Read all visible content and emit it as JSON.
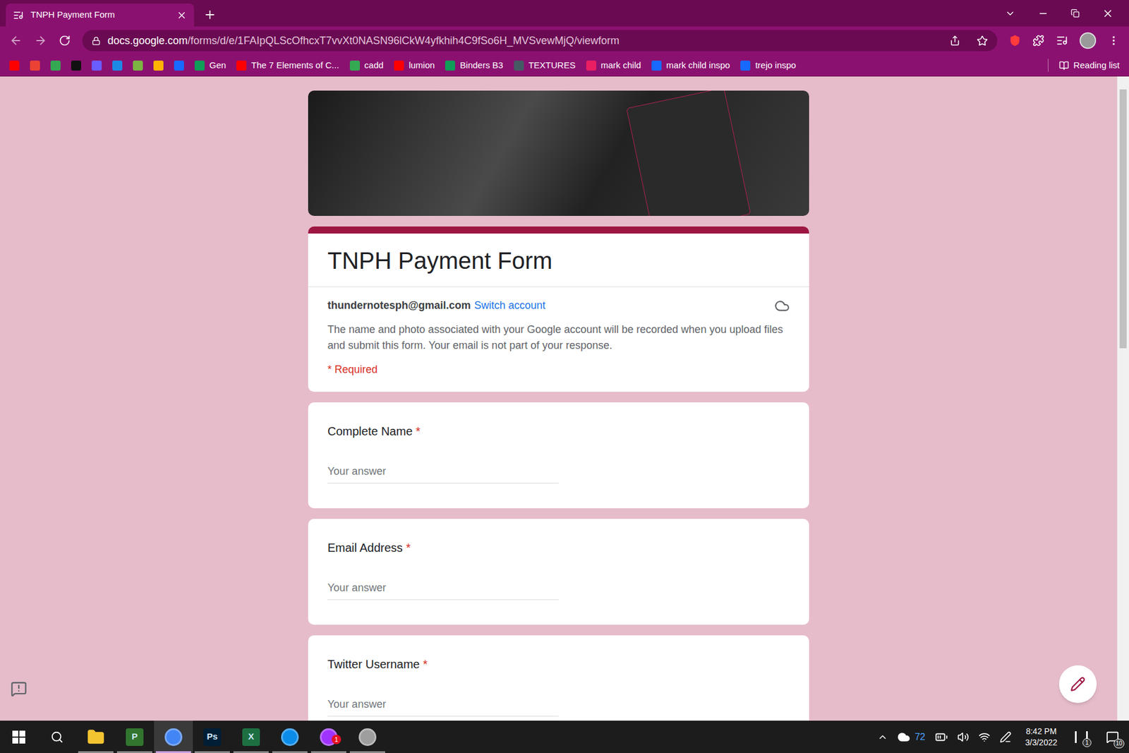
{
  "browser": {
    "tab": {
      "title": "TNPH Payment Form",
      "selected": true
    },
    "url_host": "docs.google.com",
    "url_path": "/forms/d/e/1FAIpQLScOfhcxT7vvXt0NASN96lCkW4yfkhih4C9fSo6H_MVSvewMjQ/viewform"
  },
  "bookmarks": [
    {
      "label": "",
      "color": "#ff0000"
    },
    {
      "label": "",
      "color": "#ea4335"
    },
    {
      "label": "",
      "color": "#34a853"
    },
    {
      "label": "",
      "color": "#111111"
    },
    {
      "label": "",
      "color": "#6a5cff"
    },
    {
      "label": "",
      "color": "#1e88e5"
    },
    {
      "label": "",
      "color": "#7cb342"
    },
    {
      "label": "",
      "color": "#ffb300"
    },
    {
      "label": "",
      "color": "#1769ff"
    },
    {
      "label": "Gen",
      "color": "#0f9d58"
    },
    {
      "label": "The 7 Elements of C...",
      "color": "#ff0000"
    },
    {
      "label": "cadd",
      "color": "#34a853"
    },
    {
      "label": "lumion",
      "color": "#ff0000"
    },
    {
      "label": "Binders B3",
      "color": "#0f9d58"
    },
    {
      "label": "TEXTURES",
      "color": "#455a64"
    },
    {
      "label": "mark child",
      "color": "#e91e63"
    },
    {
      "label": "mark child inspo",
      "color": "#1769ff"
    },
    {
      "label": "trejo inspo",
      "color": "#1769ff"
    }
  ],
  "reading_list": "Reading list",
  "form": {
    "title": "TNPH Payment Form",
    "account": "thundernotesph@gmail.com",
    "switch_account": "Switch account",
    "notice": "The name and photo associated with your Google account will be recorded when you upload files and submit this form. Your email is not part of your response.",
    "required_note": "* Required",
    "questions": [
      {
        "label": "Complete Name",
        "required": true,
        "placeholder": "Your answer"
      },
      {
        "label": "Email Address",
        "required": true,
        "placeholder": "Your answer"
      },
      {
        "label": "Twitter Username",
        "required": true,
        "placeholder": "Your answer"
      }
    ]
  },
  "taskbar": {
    "apps": [
      {
        "name": "file-explorer",
        "glyph": "",
        "color": "#f4c430",
        "open": true,
        "selected": false,
        "badge": ""
      },
      {
        "name": "project",
        "glyph": "P",
        "color": "#31752f",
        "open": true,
        "selected": false,
        "badge": ""
      },
      {
        "name": "chrome",
        "glyph": "",
        "color": "#4285f4",
        "open": true,
        "selected": true,
        "badge": ""
      },
      {
        "name": "photoshop",
        "glyph": "Ps",
        "color": "#001e36",
        "open": true,
        "selected": false,
        "badge": ""
      },
      {
        "name": "excel",
        "glyph": "X",
        "color": "#1d6f42",
        "open": true,
        "selected": false,
        "badge": ""
      },
      {
        "name": "edge",
        "glyph": "",
        "color": "#0c8ce9",
        "open": true,
        "selected": false,
        "badge": ""
      },
      {
        "name": "messenger",
        "glyph": "",
        "color": "#a033ff",
        "open": true,
        "selected": false,
        "badge": "1"
      },
      {
        "name": "printer",
        "glyph": "",
        "color": "#9e9e9e",
        "open": true,
        "selected": false,
        "badge": ""
      }
    ],
    "temperature": "72",
    "time": "8:42 PM",
    "date": "3/3/2022",
    "app_badge": "1",
    "notifications": "10"
  }
}
